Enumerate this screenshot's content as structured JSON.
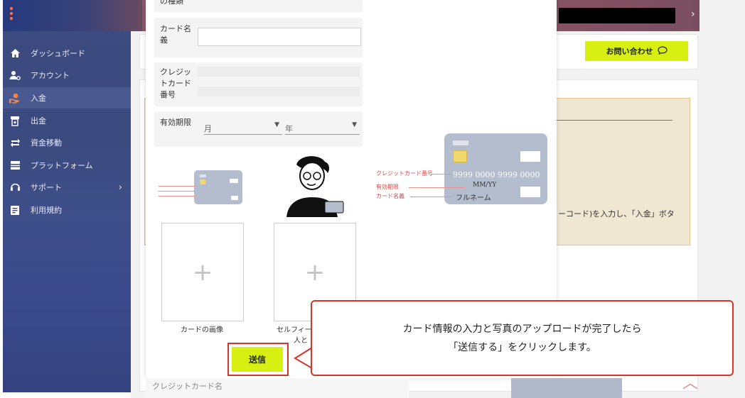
{
  "sidebar": {
    "items": [
      {
        "label": "ダッシュボード",
        "icon": "home-icon"
      },
      {
        "label": "アカウント",
        "icon": "user-gear-icon"
      },
      {
        "label": "入金",
        "icon": "deposit-icon"
      },
      {
        "label": "出金",
        "icon": "withdraw-icon"
      },
      {
        "label": "資金移動",
        "icon": "transfer-icon"
      },
      {
        "label": "プラットフォーム",
        "icon": "platform-icon"
      },
      {
        "label": "サポート",
        "icon": "support-icon"
      },
      {
        "label": "利用規約",
        "icon": "terms-icon"
      }
    ],
    "active_index": 2
  },
  "header": {
    "contact_label": "お問い合わせ"
  },
  "notice": {
    "text": "ーコード)を入力し、「入金」ボタ"
  },
  "modal": {
    "partial_label": "の種類",
    "card_name_label": "カード名義",
    "card_number_label": "クレジットカード番号",
    "expiry_label": "有効期限",
    "month_placeholder": "月",
    "year_placeholder": "年",
    "card_image_label": "カードの画像",
    "selfie_label_line1": "セルフィー",
    "selfie_label_line2": "人と",
    "submit_label": "送信"
  },
  "card_illustration": {
    "number_label": "クレジットカード番号",
    "expiry_label": "有効期限",
    "name_label": "カード名義",
    "number_value": "9999 0000 9999 0000",
    "expiry_value": "MM/YY",
    "name_value": "フルネーム"
  },
  "callout": {
    "line1": "カード情報の入力と写真のアップロードが完了したら",
    "line2": "「送信する」をクリックします。"
  },
  "bottom": {
    "card_name_label": "クレジットカード名"
  },
  "colors": {
    "accent": "#d7f012",
    "highlight_border": "#d93428"
  }
}
